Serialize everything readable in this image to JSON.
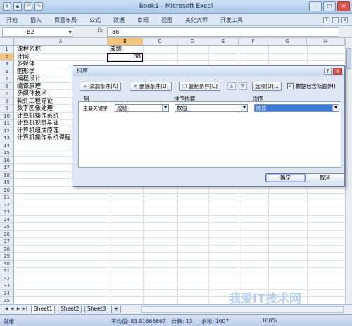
{
  "window": {
    "title": "Book1 - Microsoft Excel",
    "min": "–",
    "max": "□",
    "close": "×"
  },
  "ribbon": {
    "tabs": [
      "开始",
      "插入",
      "页面布局",
      "公式",
      "数据",
      "审阅",
      "视图",
      "美化大师",
      "开发工具"
    ]
  },
  "formula_bar": {
    "name_box": "B2",
    "fx": "fx",
    "value": "88"
  },
  "sheet": {
    "columns": [
      "A",
      "B",
      "C",
      "D",
      "E",
      "F",
      "G",
      "H"
    ],
    "rows": [
      "1",
      "2",
      "3",
      "4",
      "5",
      "6",
      "7",
      "8",
      "9",
      "10",
      "11",
      "12",
      "13",
      "14",
      "15",
      "16",
      "17",
      "18",
      "19",
      "20",
      "21",
      "22",
      "23",
      "24",
      "25",
      "26",
      "27",
      "28",
      "29",
      "30",
      "31",
      "32",
      "33",
      "34",
      "35"
    ],
    "colA": [
      "课程名称",
      "计网",
      "多媒体",
      "图形学",
      "编程设计",
      "编译原理",
      "多媒体技术",
      "软件工程导论",
      "数字图像处理",
      "计算机操作系统",
      "计算机视觉基础",
      "计算机组成原理",
      "计算机操作系统课程"
    ],
    "b1": "成绩",
    "b2": "88"
  },
  "tabs": {
    "sheets": [
      "Sheet1",
      "Sheet2",
      "Sheet3"
    ]
  },
  "status": {
    "ready": "就绪",
    "average": "平均值: 83.91666667",
    "count": "计数: 13",
    "sum": "求和: 1007",
    "zoom": "100%"
  },
  "dialog": {
    "title": "排序",
    "help": "?",
    "close": "×",
    "add_level": "添加条件(A)",
    "delete_level": "删除条件(D)",
    "copy_level": "复制条件(C)",
    "up": "▲",
    "down": "▼",
    "options": "选项(O)...",
    "header_checkbox": "数据包含标题(H)",
    "col_header": "列",
    "sort_on_header": "排序依据",
    "order_header": "次序",
    "row_label": "主要关键字",
    "column_value": "成绩",
    "sort_on_value": "数值",
    "order_value": "降序",
    "ok": "确定",
    "cancel": "取消"
  },
  "watermark": "我爱IT技术网"
}
